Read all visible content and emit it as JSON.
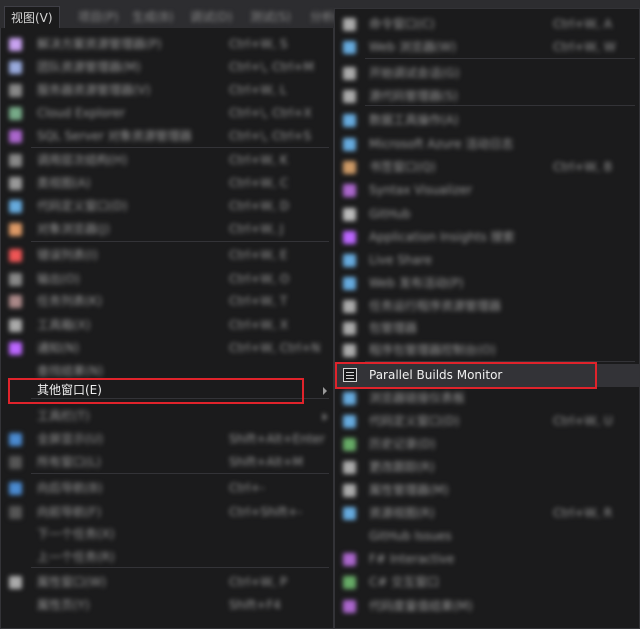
{
  "menubar": {
    "items": [
      {
        "label": "视图(V)",
        "active": true
      },
      {
        "label": "项目(P)",
        "active": false
      },
      {
        "label": "生成(B)",
        "active": false
      },
      {
        "label": "调试(D)",
        "active": false
      },
      {
        "label": "测试(S)",
        "active": false
      },
      {
        "label": "分析(N)",
        "active": false
      }
    ]
  },
  "left_menu": {
    "items": [
      {
        "label": "解决方案资源管理器(P)",
        "shortcut": "Ctrl+W, S",
        "icon": "solution-explorer-icon",
        "color": "#c8a2f0"
      },
      {
        "label": "团队资源管理器(M)",
        "shortcut": "Ctrl+\\, Ctrl+M",
        "icon": "team-explorer-icon",
        "color": "#9ad"
      },
      {
        "label": "服务器资源管理器(V)",
        "shortcut": "Ctrl+W, L",
        "icon": "server-explorer-icon",
        "color": "#888"
      },
      {
        "label": "Cloud Explorer",
        "shortcut": "Ctrl+\\, Ctrl+X",
        "icon": "cloud-explorer-icon",
        "color": "#7a8"
      },
      {
        "label": "SQL Server 对象资源管理器",
        "shortcut": "Ctrl+\\, Ctrl+S",
        "icon": "sql-server-icon",
        "color": "#a6c"
      },
      {
        "label": "调用层次结构(H)",
        "shortcut": "Ctrl+W, K",
        "icon": "call-hierarchy-icon",
        "color": "#888"
      },
      {
        "label": "类视图(A)",
        "shortcut": "Ctrl+W, C",
        "icon": "class-view-icon",
        "color": "#999"
      },
      {
        "label": "代码定义窗口(D)",
        "shortcut": "Ctrl+W, D",
        "icon": "code-definition-icon",
        "color": "#6ad"
      },
      {
        "label": "对象浏览器(J)",
        "shortcut": "Ctrl+W, J",
        "icon": "object-browser-icon",
        "color": "#d96"
      },
      {
        "label": "错误列表(I)",
        "shortcut": "Ctrl+W, E",
        "icon": "error-list-icon",
        "color": "#e55"
      },
      {
        "label": "输出(O)",
        "shortcut": "Ctrl+W, O",
        "icon": "output-icon",
        "color": "#888"
      },
      {
        "label": "任务列表(K)",
        "shortcut": "Ctrl+W, T",
        "icon": "task-list-icon",
        "color": "#a88"
      },
      {
        "label": "工具箱(X)",
        "shortcut": "Ctrl+W, X",
        "icon": "toolbox-icon",
        "color": "#aaa"
      },
      {
        "label": "通知(N)",
        "shortcut": "Ctrl+W, Ctrl+N",
        "icon": "notifications-icon",
        "color": "#b6f"
      },
      {
        "label": "查找结果(N)",
        "shortcut": "",
        "icon": "",
        "color": "#666"
      },
      {
        "label": "其他窗口(E)",
        "shortcut": "",
        "icon": "",
        "color": ""
      },
      {
        "label": "工具栏(T)",
        "shortcut": "",
        "icon": "",
        "color": ""
      },
      {
        "label": "全屏显示(U)",
        "shortcut": "Shift+Alt+Enter",
        "icon": "full-screen-icon",
        "color": "#4a8ad0"
      },
      {
        "label": "所有窗口(L)",
        "shortcut": "Shift+Alt+M",
        "icon": "all-windows-icon",
        "color": "#555"
      },
      {
        "label": "向后导航(B)",
        "shortcut": "Ctrl+-",
        "icon": "navigate-back-icon",
        "color": "#4a8ad0"
      },
      {
        "label": "向前导航(F)",
        "shortcut": "Ctrl+Shift+-",
        "icon": "navigate-forward-icon",
        "color": "#555"
      },
      {
        "label": "下一个任务(X)",
        "shortcut": "",
        "icon": "",
        "color": ""
      },
      {
        "label": "上一个任务(R)",
        "shortcut": "",
        "icon": "",
        "color": ""
      },
      {
        "label": "属性窗口(W)",
        "shortcut": "Ctrl+W, P",
        "icon": "properties-window-icon",
        "color": "#aaa"
      },
      {
        "label": "属性页(Y)",
        "shortcut": "Shift+F4",
        "icon": "",
        "color": ""
      }
    ]
  },
  "right_menu": {
    "items": [
      {
        "label": "命令窗口(C)",
        "shortcut": "Ctrl+W, A",
        "icon": "command-window-icon",
        "color": "#aaa"
      },
      {
        "label": "Web 浏览器(W)",
        "shortcut": "Ctrl+W, W",
        "icon": "web-browser-icon",
        "color": "#6ad"
      },
      {
        "label": "开始调试会话(G)",
        "shortcut": "",
        "icon": "start-debug-icon",
        "color": "#aaa"
      },
      {
        "label": "源代码管理器(S)",
        "shortcut": "",
        "icon": "source-control-icon",
        "color": "#aaa"
      },
      {
        "label": "数据工具操作(A)",
        "shortcut": "",
        "icon": "data-tools-icon",
        "color": "#6ad"
      },
      {
        "label": "Microsoft Azure 活动日志",
        "shortcut": "",
        "icon": "azure-log-icon",
        "color": "#6ad"
      },
      {
        "label": "书签窗口(Q)",
        "shortcut": "Ctrl+W, B",
        "icon": "bookmark-window-icon",
        "color": "#c96"
      },
      {
        "label": "Syntax Visualizer",
        "shortcut": "",
        "icon": "syntax-visualizer-icon",
        "color": "#a6c"
      },
      {
        "label": "GitHub",
        "shortcut": "",
        "icon": "github-icon",
        "color": "#bbb"
      },
      {
        "label": "Application Insights 搜索",
        "shortcut": "",
        "icon": "app-insights-icon",
        "color": "#b6f"
      },
      {
        "label": "Live Share",
        "shortcut": "",
        "icon": "live-share-icon",
        "color": "#6ad"
      },
      {
        "label": "Web 发布活动(P)",
        "shortcut": "",
        "icon": "web-publish-icon",
        "color": "#6ad"
      },
      {
        "label": "任务运行程序资源管理器",
        "shortcut": "",
        "icon": "task-runner-icon",
        "color": "#aaa"
      },
      {
        "label": "包管理器",
        "shortcut": "",
        "icon": "package-manager-icon",
        "color": "#aaa"
      },
      {
        "label": "程序包管理器控制台(O)",
        "shortcut": "",
        "icon": "package-console-icon",
        "color": "#aaa"
      },
      {
        "label": "Parallel Builds Monitor",
        "shortcut": "",
        "icon": "parallel-builds-icon",
        "color": "#d6d6d6"
      },
      {
        "label": "浏览器链接仪表板",
        "shortcut": "",
        "icon": "browser-link-icon",
        "color": "#6ad"
      },
      {
        "label": "代码定义窗口(D)",
        "shortcut": "Ctrl+W, U",
        "icon": "code-definition-icon",
        "color": "#6ad"
      },
      {
        "label": "历史记录(D)",
        "shortcut": "",
        "icon": "history-icon",
        "color": "#6a6"
      },
      {
        "label": "更改跟踪(R)",
        "shortcut": "",
        "icon": "change-tracking-icon",
        "color": "#aaa"
      },
      {
        "label": "属性管理器(M)",
        "shortcut": "",
        "icon": "property-manager-icon",
        "color": "#aaa"
      },
      {
        "label": "资源视图(R)",
        "shortcut": "Ctrl+W, R",
        "icon": "resource-view-icon",
        "color": "#6ad"
      },
      {
        "label": "GitHub Issues",
        "shortcut": "",
        "icon": "",
        "color": ""
      },
      {
        "label": "F# Interactive",
        "shortcut": "",
        "icon": "fsharp-icon",
        "color": "#a6c"
      },
      {
        "label": "C# 交互窗口",
        "shortcut": "",
        "icon": "csharp-icon",
        "color": "#6a6"
      },
      {
        "label": "代码度量值结果(M)",
        "shortcut": "",
        "icon": "code-metrics-icon",
        "color": "#a6c"
      }
    ]
  }
}
